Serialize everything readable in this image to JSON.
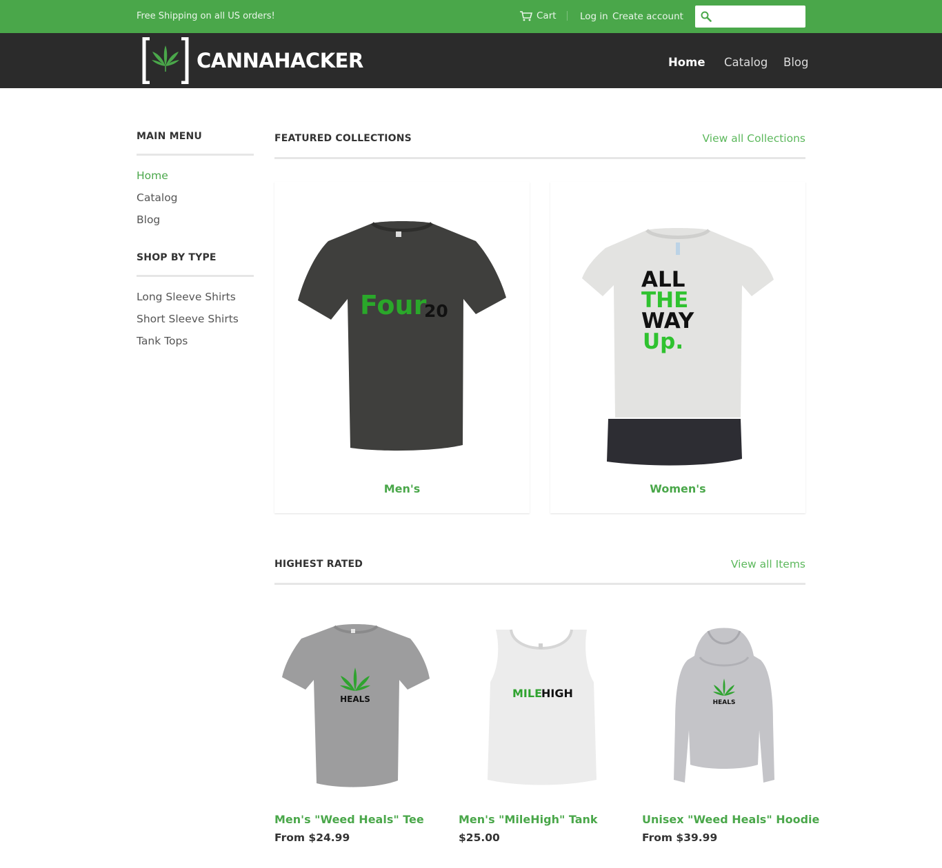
{
  "topbar": {
    "promo": "Free Shipping on all US orders!",
    "cart": "Cart",
    "login": "Log in",
    "create_account": "Create account",
    "search_placeholder": ""
  },
  "header": {
    "brand": "CANNAHACKER",
    "nav": [
      "Home",
      "Catalog",
      "Blog"
    ]
  },
  "sidebar": {
    "main_menu_title": "MAIN MENU",
    "main_menu": [
      "Home",
      "Catalog",
      "Blog"
    ],
    "shop_title": "SHOP BY TYPE",
    "shop_items": [
      "Long Sleeve Shirts",
      "Short Sleeve Shirts",
      "Tank Tops"
    ]
  },
  "featured": {
    "title": "FEATURED COLLECTIONS",
    "link": "View all Collections",
    "collections": [
      {
        "label": "Men's",
        "print_a": "Four",
        "print_b": "20"
      },
      {
        "label": "Women's",
        "print_lines": [
          "ALL",
          "THE",
          "WAY",
          "Up."
        ]
      }
    ]
  },
  "highest_rated": {
    "title": "HIGHEST RATED",
    "link": "View all Items",
    "products": [
      {
        "title": "Men's \"Weed Heals\" Tee",
        "price": "From $24.99",
        "print": "HEALS"
      },
      {
        "title": "Men's \"MileHigh\" Tank",
        "price": "$25.00",
        "print_a": "MILE",
        "print_b": "HIGH"
      },
      {
        "title": "Unisex \"Weed Heals\" Hoodie",
        "price": "From $39.99",
        "print": "HEALS"
      }
    ]
  },
  "colors": {
    "accent": "#4aa74a",
    "header_bg": "#2b2b2b",
    "leaf": "#2fa32f"
  }
}
